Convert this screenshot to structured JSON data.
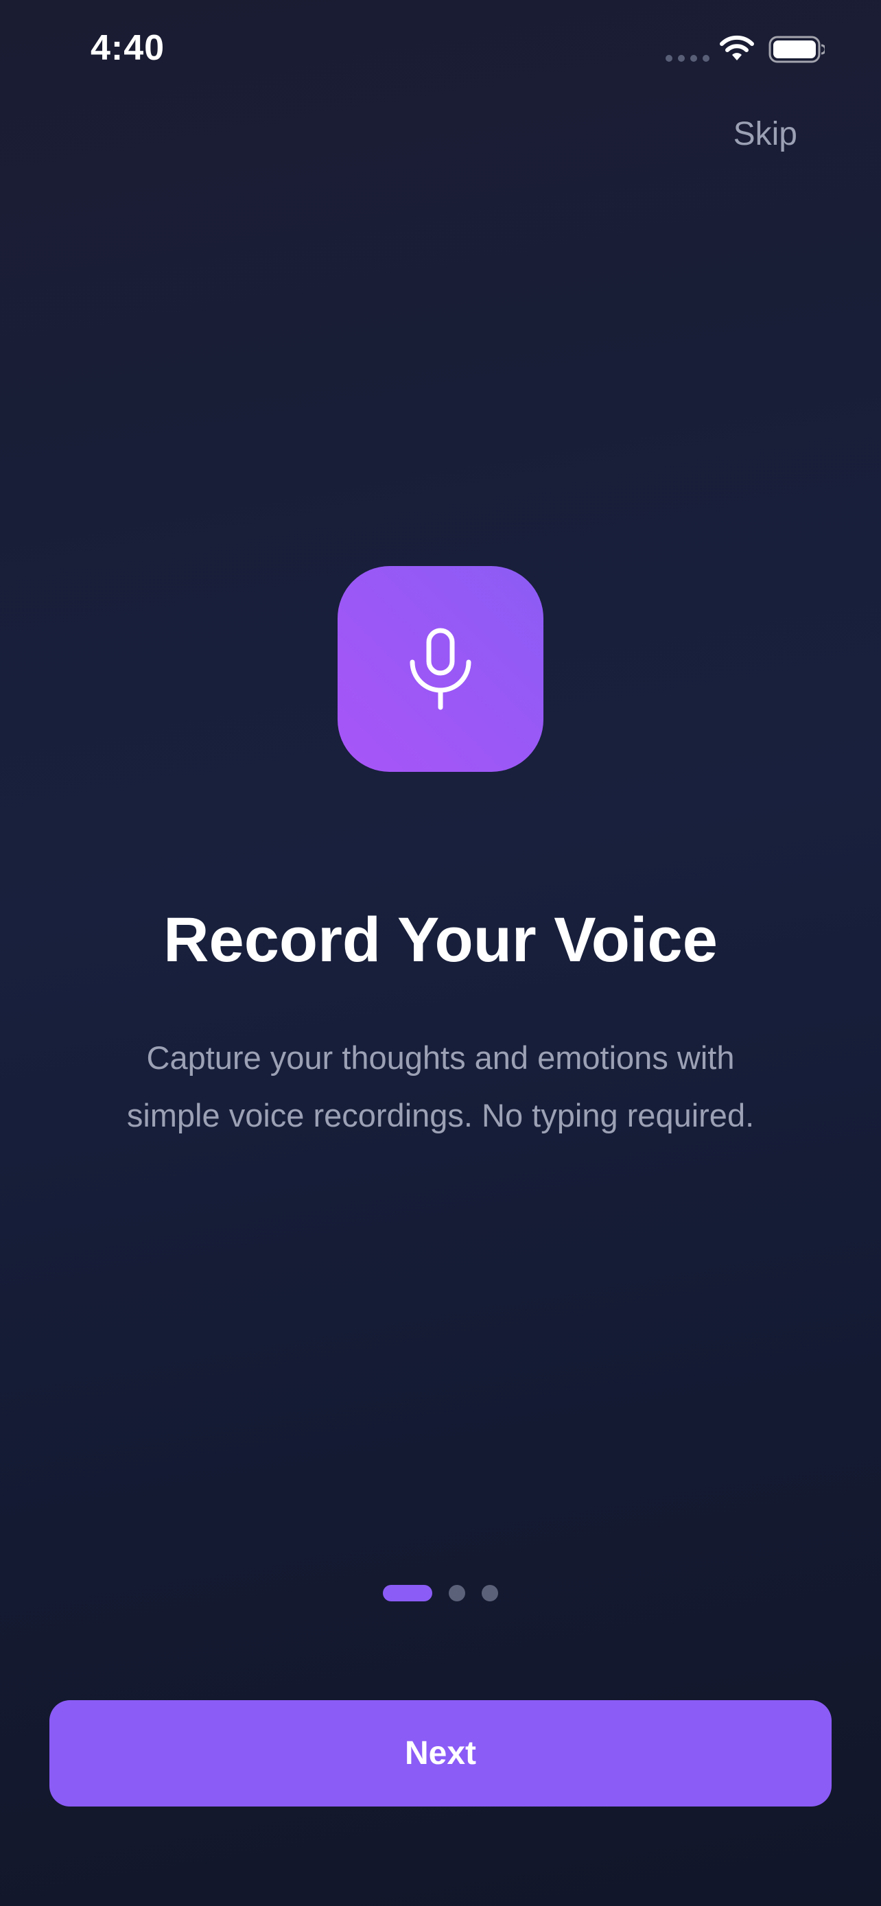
{
  "status_bar": {
    "time": "4:40",
    "icons": [
      "signal-dots-icon",
      "wifi-icon",
      "battery-icon"
    ]
  },
  "header": {
    "skip_label": "Skip"
  },
  "hero": {
    "icon": "microphone-icon",
    "title": "Record Your Voice",
    "subtitle_line1": "Capture your thoughts and emotions with",
    "subtitle_line2": "simple voice recordings. No typing required."
  },
  "pager": {
    "total_pages": 3,
    "current_page": 1
  },
  "footer": {
    "next_label": "Next"
  },
  "colors": {
    "accent": "#8b5cf6",
    "icon_gradient_start": "#a855f7",
    "icon_gradient_end": "#8c5cf5",
    "background": "#18203d",
    "muted_text": "#9ca1b5",
    "inactive_dot": "#5b6178"
  }
}
